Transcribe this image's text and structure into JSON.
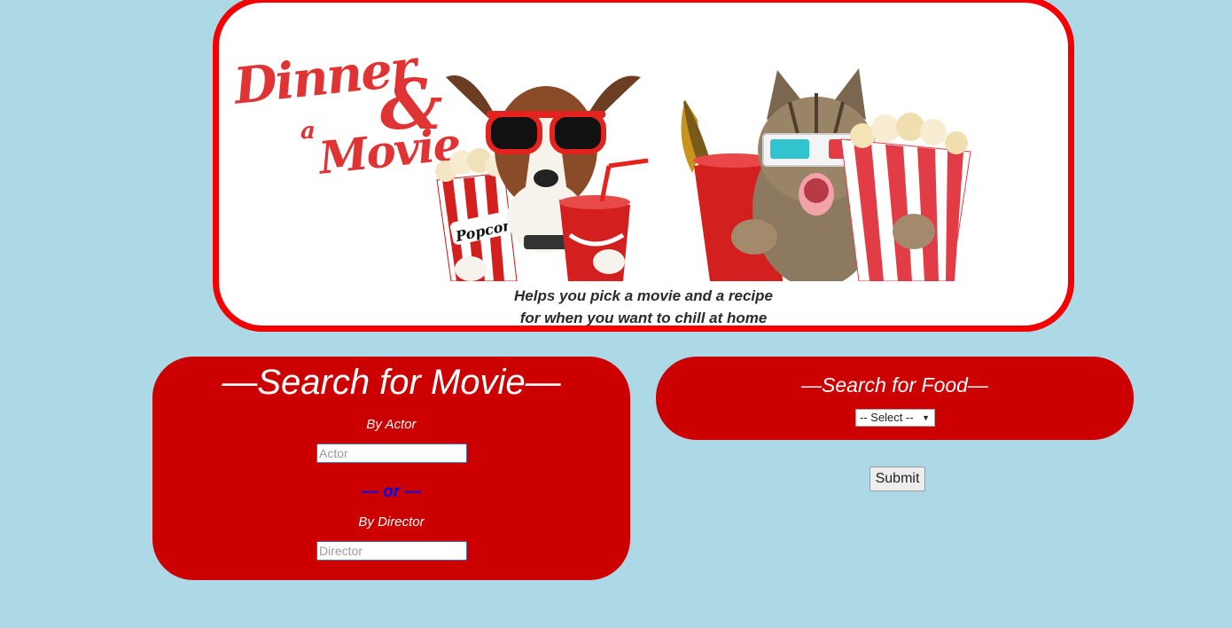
{
  "banner": {
    "logo": {
      "line1": "Dinner",
      "amp": "&",
      "line2": "a",
      "line3": "Movie"
    },
    "popcorn_label": "Popcorn",
    "tagline_line1": "Helps you pick a movie and a recipe",
    "tagline_line2": "for when you want to chill at home"
  },
  "movie_search": {
    "title": "—Search for Movie—",
    "actor_label": "By Actor",
    "actor_placeholder": "Actor",
    "separator": "— or —",
    "director_label": "By Director",
    "director_placeholder": "Director"
  },
  "food_search": {
    "title": "—Search for Food—",
    "select_value": "-- Select --"
  },
  "submit_label": "Submit",
  "colors": {
    "background": "#add8e6",
    "panel": "#cc0000",
    "banner_border": "#f50000",
    "separator": "#0000ee"
  }
}
